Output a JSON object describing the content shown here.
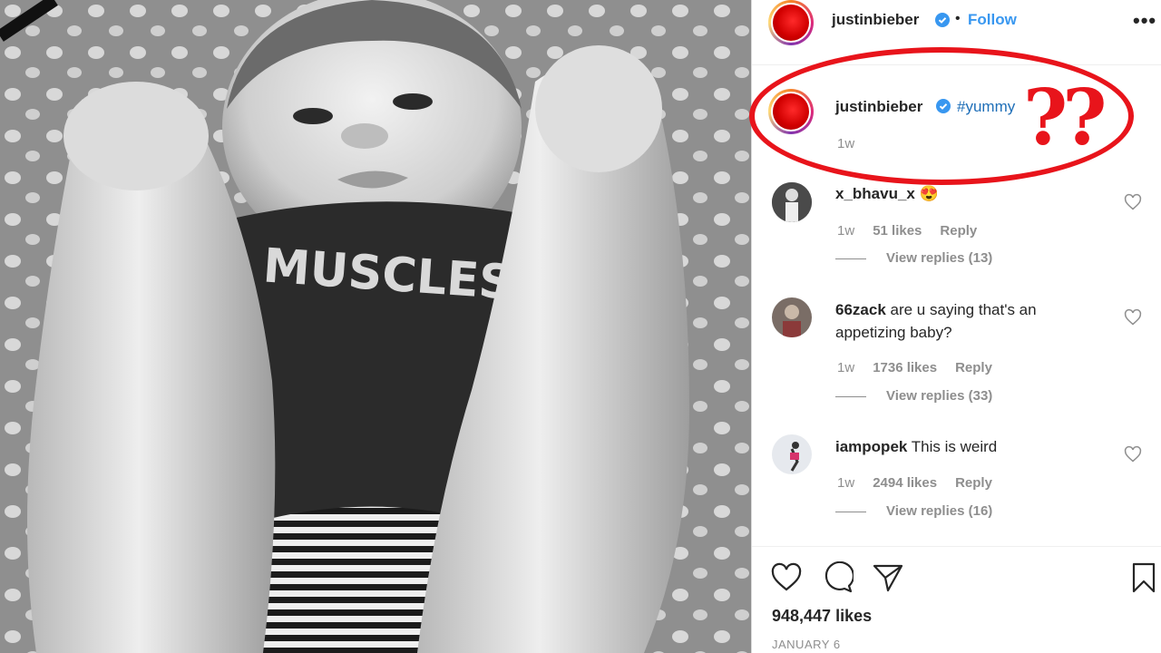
{
  "post": {
    "username": "justinbieber",
    "dot": "•",
    "follow_label": "Follow",
    "more_label": "•••",
    "caption_tag": "#yummy",
    "caption_time": "1w",
    "photo_shirt_text": "MUSCLES",
    "total_likes": "948,447 likes",
    "date": "JANUARY 6"
  },
  "comments": [
    {
      "user": "x_bhavu_x",
      "text": "😍",
      "time": "1w",
      "likes": "51 likes",
      "reply": "Reply",
      "view_replies": "View replies (13)"
    },
    {
      "user": "66zack",
      "text": "are u saying that's an appetizing baby?",
      "time": "1w",
      "likes": "1736 likes",
      "reply": "Reply",
      "view_replies": "View replies (33)"
    },
    {
      "user": "iampopek",
      "text": "This is weird",
      "time": "1w",
      "likes": "2494 likes",
      "reply": "Reply",
      "view_replies": "View replies (16)"
    }
  ],
  "annotation": {
    "text": "??",
    "color": "#e8141b"
  },
  "colors": {
    "link": "#3897f0",
    "hashtag": "#1f6fb8",
    "muted": "#8e8e8e",
    "verified": "#3897f0"
  },
  "icons": [
    "verified-icon",
    "more-icon",
    "heart-icon",
    "comment-icon",
    "share-icon",
    "bookmark-icon"
  ]
}
